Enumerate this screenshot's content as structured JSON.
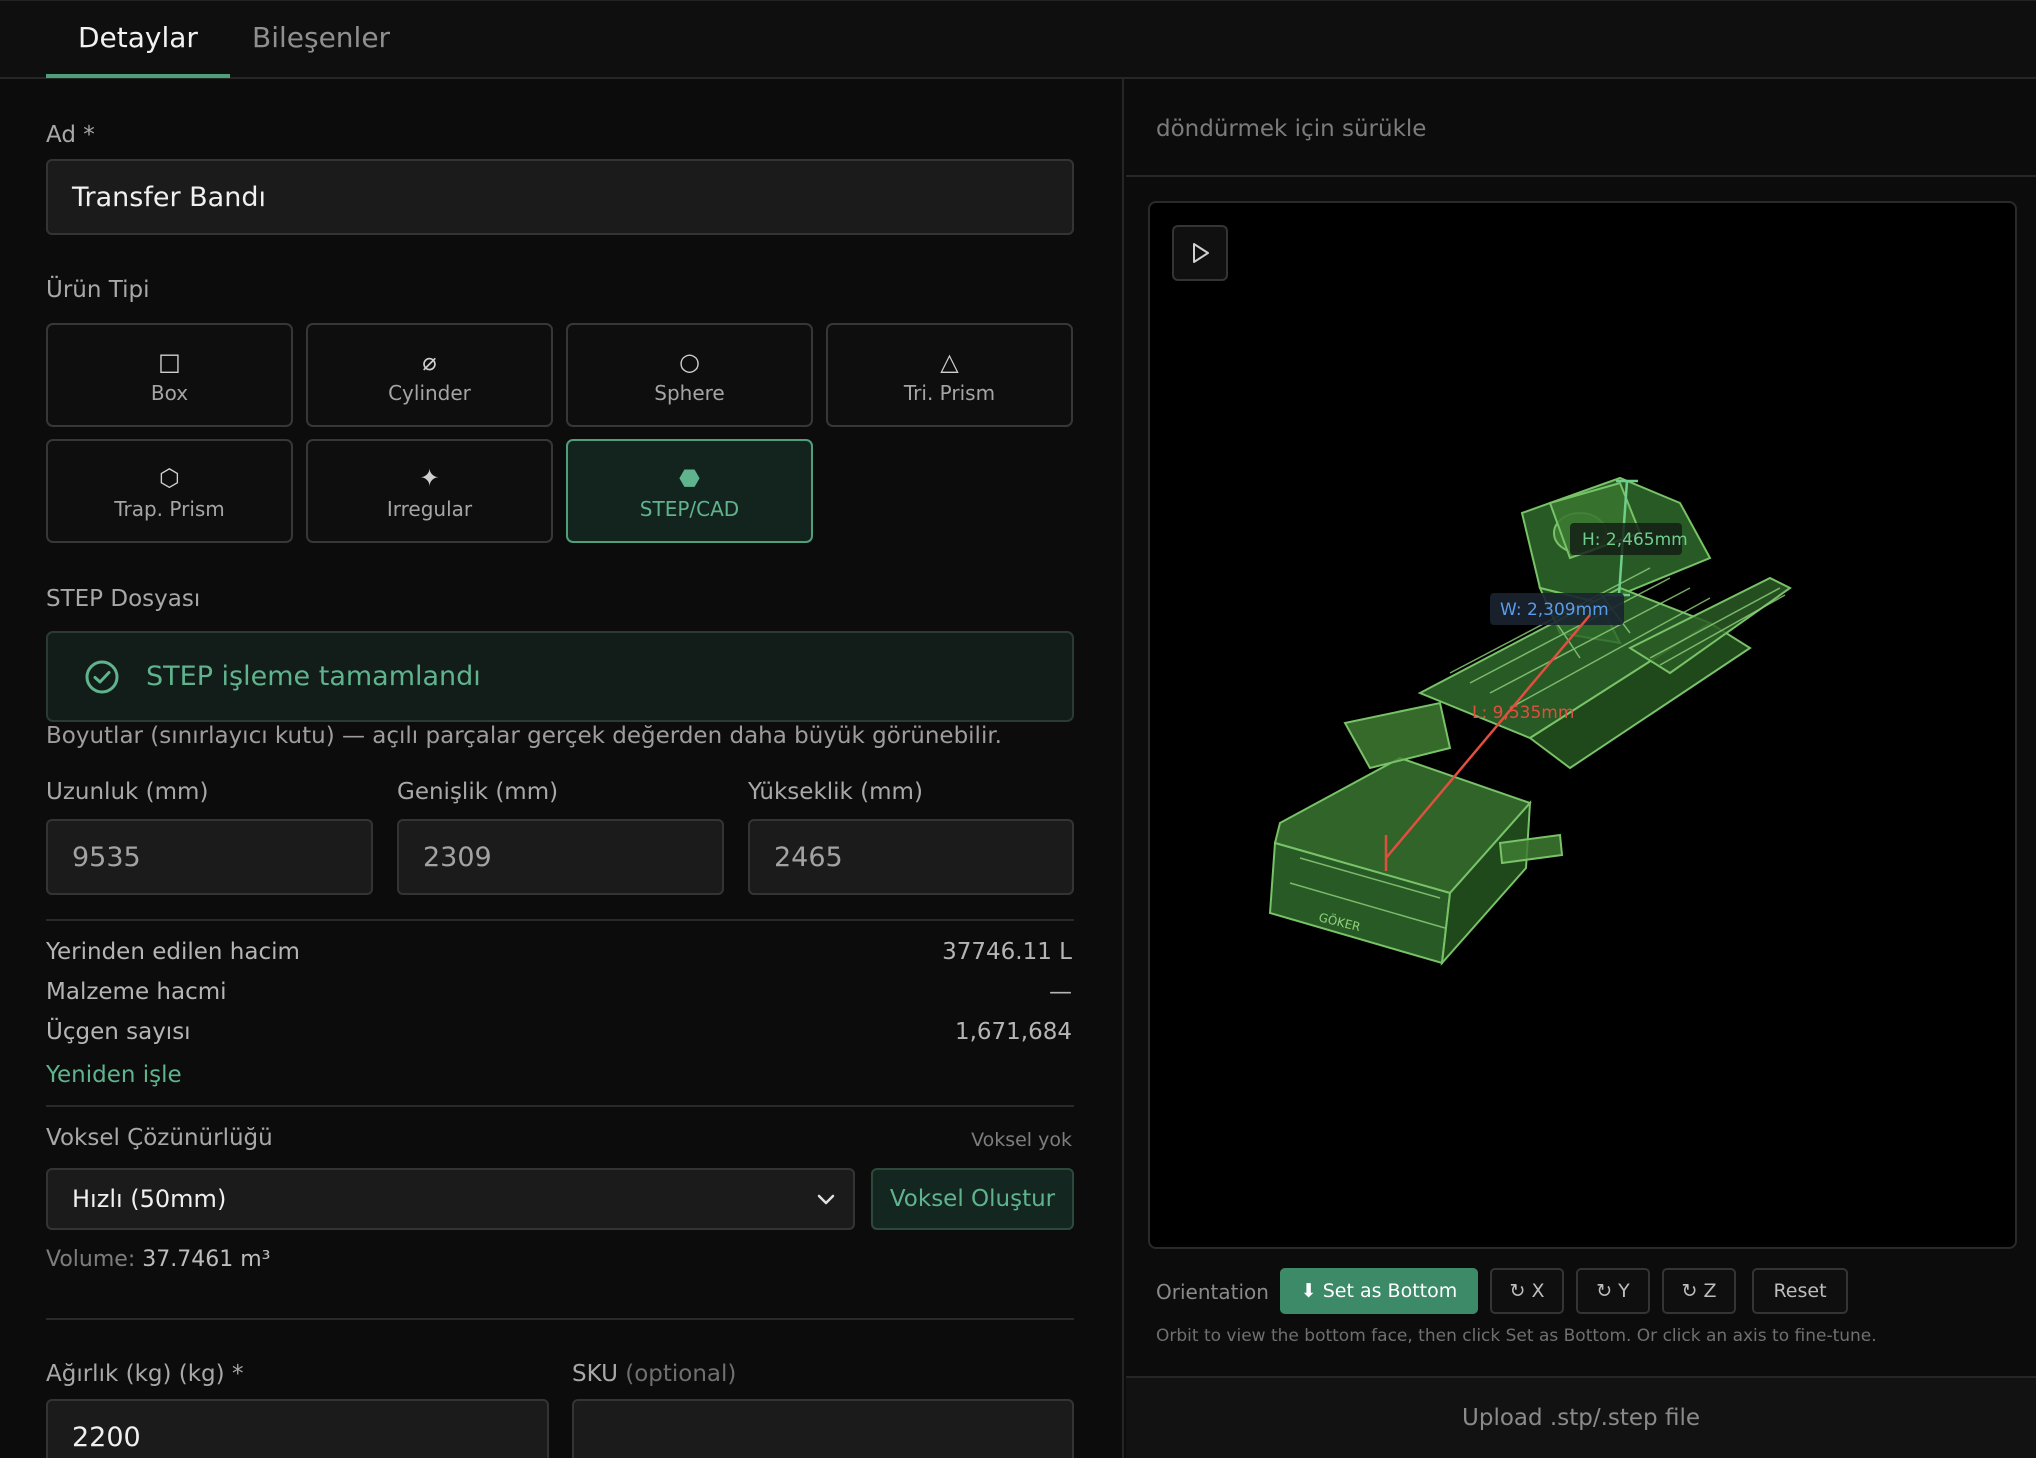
{
  "tabs": [
    {
      "label": "Detaylar",
      "active": true
    },
    {
      "label": "Bileşenler",
      "active": false
    }
  ],
  "form": {
    "name_label": "Ad *",
    "name_value": "Transfer Bandı",
    "product_type_label": "Ürün Tipi",
    "product_types": [
      {
        "label": "Box",
        "icon": "□",
        "icon_name": "box-icon"
      },
      {
        "label": "Cylinder",
        "icon": "⌀",
        "icon_name": "cylinder-icon"
      },
      {
        "label": "Sphere",
        "icon": "○",
        "icon_name": "sphere-icon"
      },
      {
        "label": "Tri. Prism",
        "icon": "△",
        "icon_name": "triangle-icon"
      },
      {
        "label": "Trap. Prism",
        "icon": "⬡",
        "icon_name": "hexagon-icon"
      },
      {
        "label": "Irregular",
        "icon": "✦",
        "icon_name": "star-icon"
      },
      {
        "label": "STEP/CAD",
        "icon": "⬣",
        "icon_name": "filled-hexagon-icon",
        "selected": true
      }
    ],
    "step_file_label": "STEP Dosyası",
    "step_status": "STEP işleme tamamlandı",
    "bbox_note": "Boyutlar (sınırlayıcı kutu) — açılı parçalar gerçek değerden daha büyük görünebilir.",
    "dimensions": {
      "length_label": "Uzunluk (mm)",
      "length_value": "9535",
      "width_label": "Genişlik (mm)",
      "width_value": "2309",
      "height_label": "Yükseklik (mm)",
      "height_value": "2465"
    },
    "stats": {
      "displaced_label": "Yerinden edilen hacim",
      "displaced_value": "37746.11 L",
      "material_label": "Malzeme hacmi",
      "material_value": "—",
      "triangle_label": "Üçgen sayısı",
      "triangle_value": "1,671,684"
    },
    "reprocess_link": "Yeniden işle",
    "voxel": {
      "label": "Voksel Çözünürlüğü",
      "status": "Voksel yok",
      "selected_option": "Hızlı (50mm)",
      "generate_button": "Voksel Oluştur",
      "volume_label": "Volume:",
      "volume_value": "37.7461 m³"
    },
    "weight_label": "Ağırlık (kg) (kg) *",
    "weight_value": "2200",
    "sku_label": "SKU",
    "sku_optional": "(optional)",
    "sku_value": ""
  },
  "viewer": {
    "hint": "döndürmek için sürükle",
    "dims": {
      "h": "H: 2,465mm",
      "w": "W: 2,309mm",
      "l": "L: 9,535mm"
    },
    "model_text": "GÖKER",
    "colors": {
      "model": "#4a8a3f",
      "height": "#6fce8c",
      "width": "#5b9be8",
      "length": "#e0503f"
    }
  },
  "orientation": {
    "label": "Orientation",
    "set_bottom": "⬇ Set as Bottom",
    "rot_x": "↻ X",
    "rot_y": "↻ Y",
    "rot_z": "↻ Z",
    "reset": "Reset",
    "hint": "Orbit to view the bottom face, then click Set as Bottom. Or click an axis to fine-tune."
  },
  "upload_label": "Upload .stp/.step file"
}
